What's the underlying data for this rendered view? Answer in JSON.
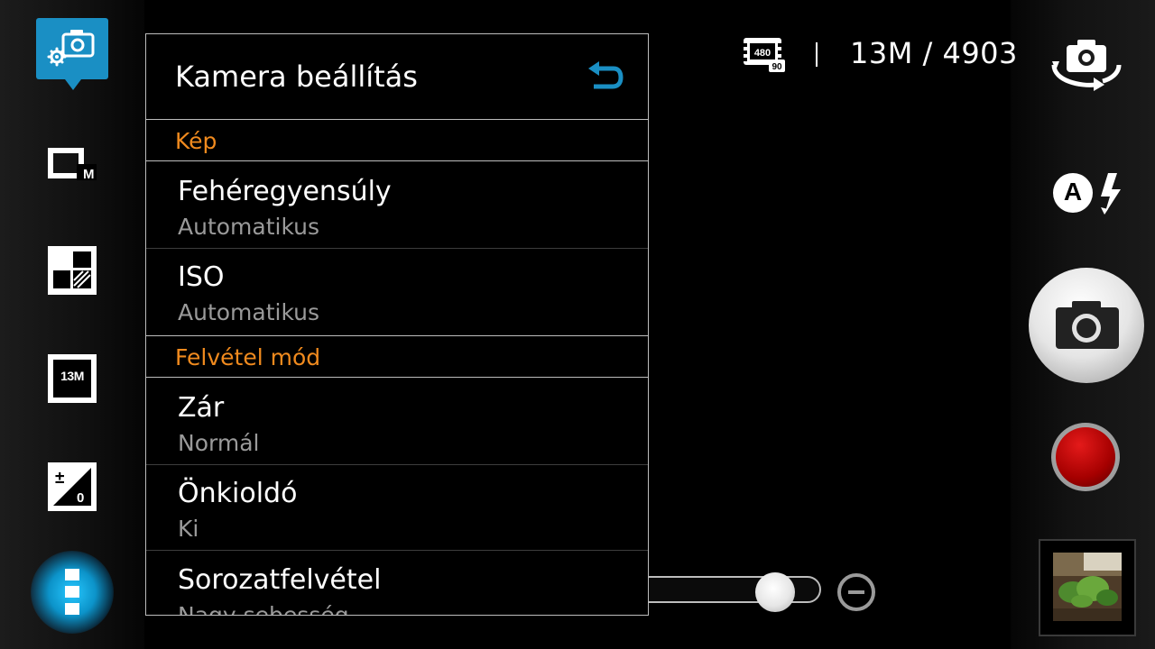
{
  "panel": {
    "title": "Kamera beállítás",
    "sections": [
      {
        "label": "Kép"
      },
      {
        "label": "Felvétel mód"
      }
    ],
    "items": [
      {
        "title": "Fehéregyensúly",
        "value": "Automatikus"
      },
      {
        "title": "ISO",
        "value": "Automatikus"
      },
      {
        "title": "Zár",
        "value": "Normál"
      },
      {
        "title": "Önkioldó",
        "value": "Ki"
      },
      {
        "title": "Sorozatfelvétel",
        "value": "Nagy sebesség"
      }
    ]
  },
  "status": {
    "video_badge_top": "480",
    "video_badge_bottom": "90",
    "resolution_remaining": "13M / 4903"
  },
  "left_toolbar": {
    "resolution_icon_label": "13M",
    "exposure_plus_minus": "±",
    "exposure_value": "0",
    "mode_icon_label": "M",
    "icons": [
      "camera-settings-icon",
      "capture-mode-icon",
      "scene-icon",
      "resolution-icon",
      "exposure-icon",
      "menu-icon"
    ]
  },
  "right_controls": {
    "flash_mode_label": "A",
    "icons": [
      "switch-camera-icon",
      "flash-auto-icon",
      "shutter-button",
      "record-button",
      "gallery-thumbnail"
    ]
  },
  "zoom": {
    "level": 0.95
  },
  "colors": {
    "accent_blue": "#1a8fc4",
    "section_orange": "#f08a1e",
    "record_red": "#b00000"
  }
}
